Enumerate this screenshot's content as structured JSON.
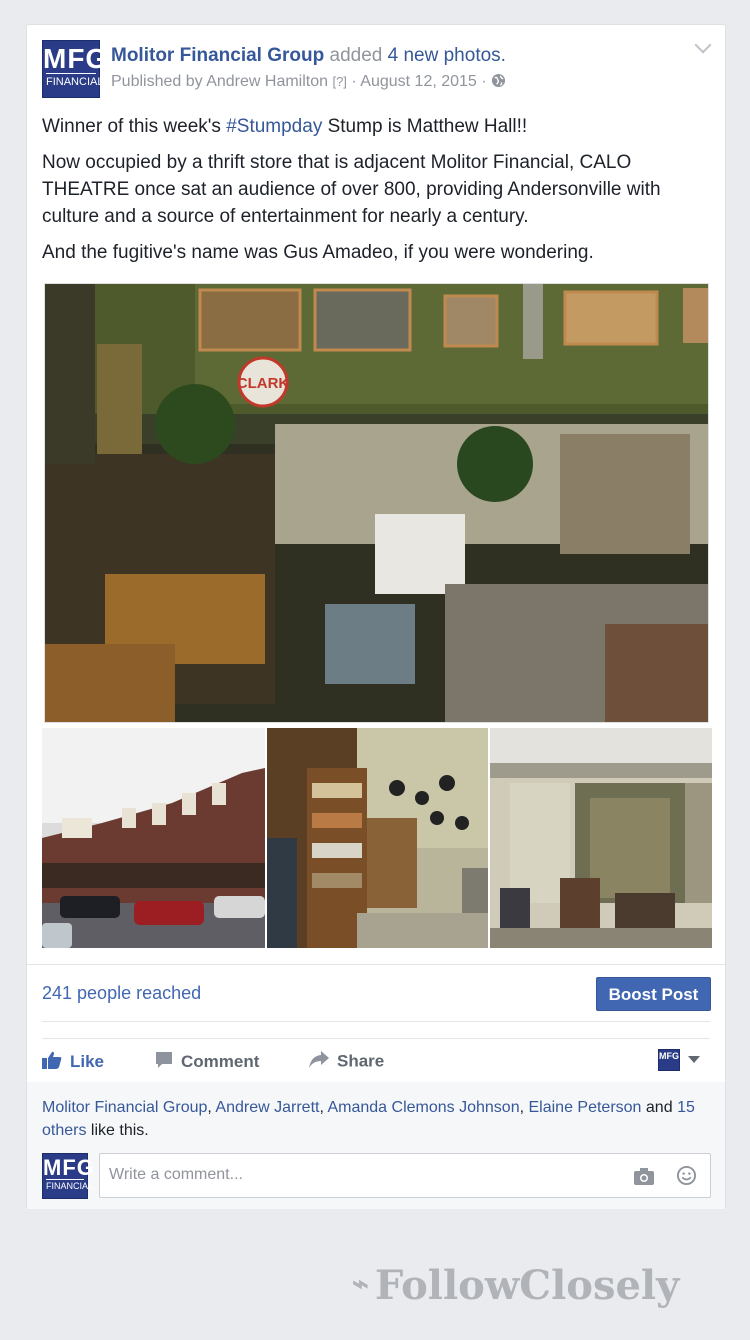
{
  "header": {
    "page_name": "Molitor Financial Group",
    "action_verb": "added",
    "action_object": "4 new photos.",
    "published_by_prefix": "Published by",
    "publisher": "Andrew Hamilton",
    "help_marker": "[?]",
    "separator": "·",
    "date": "August 12, 2015",
    "privacy_icon": "globe-icon",
    "logo": {
      "line1": "MFG",
      "line2": "FINANCIAL"
    }
  },
  "post": {
    "line1_prefix": "Winner of this week's",
    "hashtag": "#Stumpday",
    "line1_suffix": "Stump is Matthew Hall!!",
    "paragraph2": "Now occupied by a thrift store that is adjacent Molitor Financial, CALO THEATRE once sat an audience of over 800, providing Andersonville with culture and a source of entertainment for nearly a century.",
    "paragraph3": "And the fugitive's name was Gus Amadeo, if you were wondering."
  },
  "photos": {
    "main_sign": "CLARK"
  },
  "insights": {
    "reached": "241 people reached",
    "boost_label": "Boost Post"
  },
  "actions": {
    "like": "Like",
    "comment": "Comment",
    "share": "Share"
  },
  "likes": {
    "names": [
      "Molitor Financial Group",
      "Andrew Jarrett",
      "Amanda Clemons Johnson",
      "Elaine Peterson"
    ],
    "and_text": "and",
    "others": "15 others",
    "suffix": "like this."
  },
  "comment": {
    "placeholder": "Write a comment..."
  },
  "watermark": "FollowClosely",
  "colors": {
    "brand_blue": "#4267b2",
    "link_blue": "#365899",
    "logo_navy": "#2a3c88",
    "background": "#e9ebee"
  }
}
